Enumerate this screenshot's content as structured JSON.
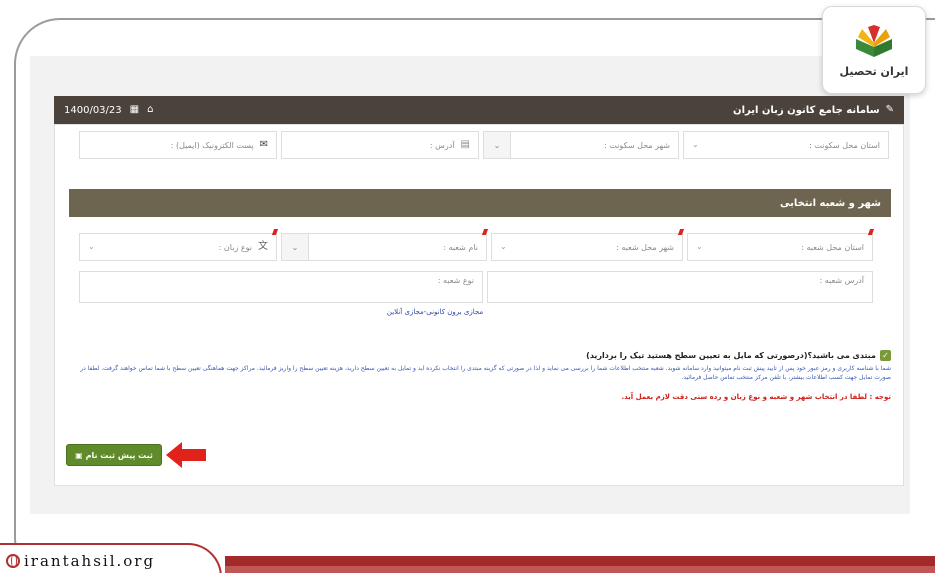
{
  "logo": {
    "text": "ایران تحصیل"
  },
  "appbar": {
    "date": "1400/03/23",
    "title": "سامانه جامع کانون زبان ایران"
  },
  "top_fields": {
    "residence_province": "استان محل سکونت :",
    "residence_city": "شهر محل سکونت :",
    "address": "آدرس :",
    "email": "پست الکترونیک (ایمیل) :"
  },
  "section": {
    "title": "شهر و شعبه انتخابی"
  },
  "branch_fields": {
    "branch_province": "استان محل شعبه :",
    "branch_city": "شهر محل شعبه :",
    "branch_name": "نام شعبه :",
    "language_type": "نوع زبان :",
    "branch_address": "آدرس شعبه :",
    "branch_type": "نوع شعبه :"
  },
  "link": {
    "text": "مجازی برون کانونی-مجازی آنلاین"
  },
  "checkbox": {
    "label": "مبتدی می باشید؟(درصورتی که مایل به تعیین سطح هستید تیک را بردارید)",
    "checked": true
  },
  "description": "شما با شناسه کاربری و رمز عبور خود پس از تایید پیش ثبت نام میتوانید وارد سامانه شوید. شعبه منتخب اطلاعات شما را بررسی می نماید و لذا در صورتی که گزینه مبتدی را انتخاب نکرده اید و تمایل به تعیین سطح دارید، هزینه تعیین سطح را واریز فرمائید. مراکز جهت هماهنگی تعیین سطح با شما تماس خواهند گرفت. لطفا در صورت تمایل جهت کسب اطلاعات بیشتر، با تلفن مرکز منتخب تماس حاصل فرمائید.",
  "warning": "توجه : لطفا در انتخاب شهر و شعبه و نوع زبان و رده سنی دقت لازم بعمل آید.",
  "submit": {
    "label": "ثبت پیش ثبت نام"
  },
  "footer": {
    "site": "irantahsil.org"
  },
  "colors": {
    "appbar": "#4b423b",
    "section": "#6e6550",
    "submit": "#5f8b2b",
    "warning": "#d0201a",
    "link": "#2c45a8",
    "footer": "#a32a2a"
  }
}
